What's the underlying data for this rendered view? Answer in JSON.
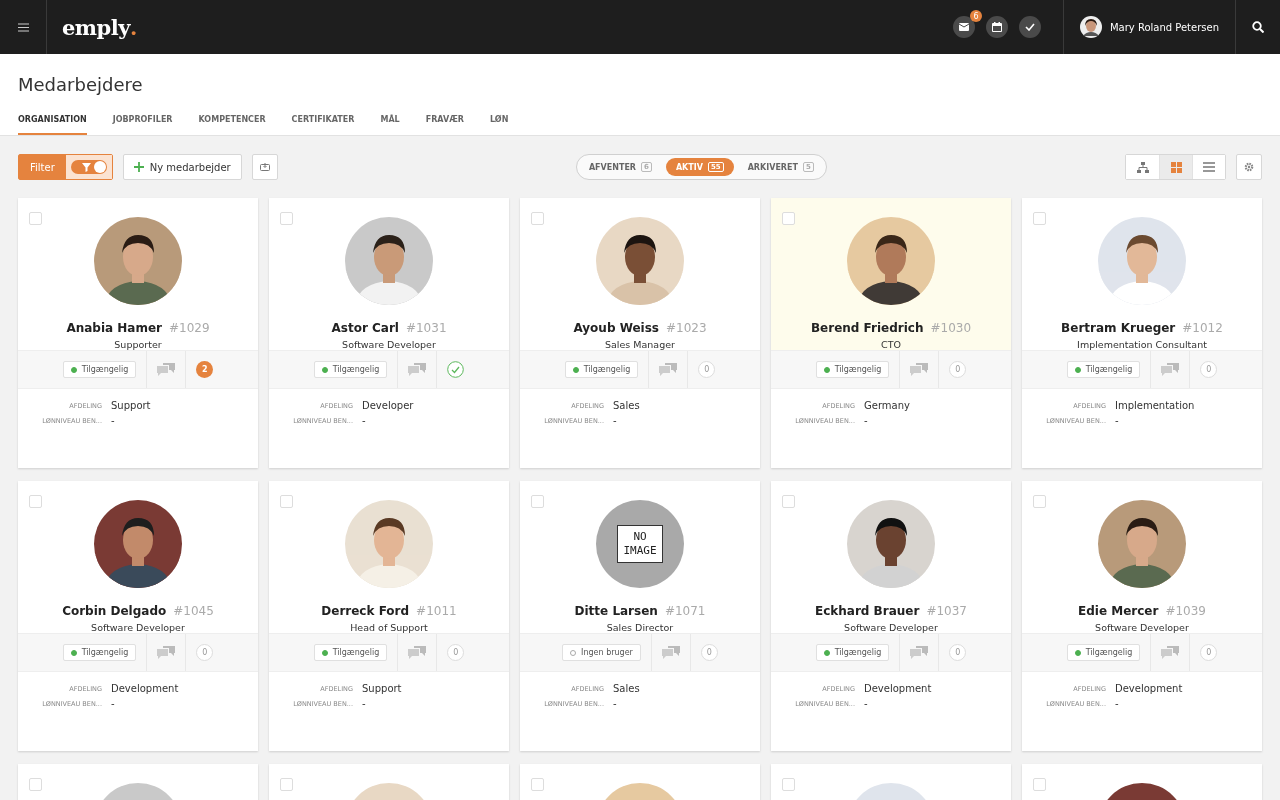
{
  "topbar": {
    "logo": "emply",
    "logo_dot": ".",
    "mail_badge": "6",
    "user": {
      "name": "Mary Roland Petersen"
    }
  },
  "page": {
    "title": "Medarbejdere"
  },
  "tabs": [
    {
      "label": "ORGANISATION",
      "selected": true
    },
    {
      "label": "JOBPROFILER",
      "selected": false
    },
    {
      "label": "KOMPETENCER",
      "selected": false
    },
    {
      "label": "CERTIFIKATER",
      "selected": false
    },
    {
      "label": "MÅL",
      "selected": false
    },
    {
      "label": "FRAVÆR",
      "selected": false
    },
    {
      "label": "LØN",
      "selected": false
    }
  ],
  "toolbar": {
    "filter": {
      "label": "Filter",
      "on": true
    },
    "new_button": {
      "label": "Ny medarbejder"
    },
    "segments": [
      {
        "label": "AFVENTER",
        "count": "6",
        "selected": false
      },
      {
        "label": "AKTIV",
        "count": "55",
        "selected": true
      },
      {
        "label": "ARKIVERET",
        "count": "5",
        "selected": false
      }
    ],
    "views": [
      {
        "kind": "org",
        "selected": false
      },
      {
        "kind": "grid",
        "selected": true
      },
      {
        "kind": "list",
        "selected": false
      }
    ]
  },
  "cards": [
    {
      "name": "Anabia Hamer",
      "number": "#1029",
      "title": "Supporter",
      "checked": false,
      "highlighted": false,
      "status": {
        "kind": "available",
        "label": "Tilgængelig"
      },
      "counter": {
        "kind": "badge",
        "value": "2"
      },
      "fields": [
        {
          "label": "AFDELING",
          "value": "Support"
        },
        {
          "label": "LØNNIVEAU BEN...",
          "value": "-"
        }
      ]
    },
    {
      "name": "Astor Carl",
      "number": "#1031",
      "title": "Software Developer",
      "checked": false,
      "highlighted": false,
      "status": {
        "kind": "available",
        "label": "Tilgængelig"
      },
      "counter": {
        "kind": "done"
      },
      "fields": [
        {
          "label": "AFDELING",
          "value": "Developer"
        },
        {
          "label": "LØNNIVEAU BEN...",
          "value": "-"
        }
      ]
    },
    {
      "name": "Ayoub Weiss",
      "number": "#1023",
      "title": "Sales Manager",
      "checked": false,
      "highlighted": false,
      "status": {
        "kind": "available",
        "label": "Tilgængelig"
      },
      "counter": {
        "kind": "count",
        "value": "0"
      },
      "fields": [
        {
          "label": "AFDELING",
          "value": "Sales"
        },
        {
          "label": "LØNNIVEAU BEN...",
          "value": "-"
        }
      ]
    },
    {
      "name": "Berend Friedrich",
      "number": "#1030",
      "title": "CTO",
      "checked": false,
      "highlighted": true,
      "status": {
        "kind": "available",
        "label": "Tilgængelig"
      },
      "counter": {
        "kind": "count",
        "value": "0"
      },
      "fields": [
        {
          "label": "AFDELING",
          "value": "Germany"
        },
        {
          "label": "LØNNIVEAU BEN...",
          "value": "-"
        }
      ]
    },
    {
      "name": "Bertram Krueger",
      "number": "#1012",
      "title": "Implementation Consultant",
      "checked": false,
      "highlighted": false,
      "status": {
        "kind": "available",
        "label": "Tilgængelig"
      },
      "counter": {
        "kind": "count",
        "value": "0"
      },
      "fields": [
        {
          "label": "AFDELING",
          "value": "Implementation"
        },
        {
          "label": "LØNNIVEAU BEN...",
          "value": "-"
        }
      ]
    },
    {
      "name": "Corbin Delgado",
      "number": "#1045",
      "title": "Software Developer",
      "checked": false,
      "highlighted": false,
      "status": {
        "kind": "available",
        "label": "Tilgængelig"
      },
      "counter": {
        "kind": "count",
        "value": "0"
      },
      "fields": [
        {
          "label": "AFDELING",
          "value": "Development"
        },
        {
          "label": "LØNNIVEAU BEN...",
          "value": "-"
        }
      ]
    },
    {
      "name": "Derreck Ford",
      "number": "#1011",
      "title": "Head of Support",
      "checked": false,
      "highlighted": false,
      "status": {
        "kind": "available",
        "label": "Tilgængelig"
      },
      "counter": {
        "kind": "count",
        "value": "0"
      },
      "fields": [
        {
          "label": "AFDELING",
          "value": "Support"
        },
        {
          "label": "LØNNIVEAU BEN...",
          "value": "-"
        }
      ]
    },
    {
      "name": "Ditte Larsen",
      "number": "#1071",
      "title": "Sales Director",
      "checked": false,
      "highlighted": false,
      "avatar": {
        "kind": "placeholder",
        "text": "NO IMAGE"
      },
      "status": {
        "kind": "no-user",
        "label": "Ingen bruger"
      },
      "counter": {
        "kind": "count",
        "value": "0"
      },
      "fields": [
        {
          "label": "AFDELING",
          "value": "Sales"
        },
        {
          "label": "LØNNIVEAU BEN...",
          "value": "-"
        }
      ]
    },
    {
      "name": "Eckhard Brauer",
      "number": "#1037",
      "title": "Software Developer",
      "checked": false,
      "highlighted": false,
      "status": {
        "kind": "available",
        "label": "Tilgængelig"
      },
      "counter": {
        "kind": "count",
        "value": "0"
      },
      "fields": [
        {
          "label": "AFDELING",
          "value": "Development"
        },
        {
          "label": "LØNNIVEAU BEN...",
          "value": "-"
        }
      ]
    },
    {
      "name": "Edie Mercer",
      "number": "#1039",
      "title": "Software Developer",
      "checked": false,
      "highlighted": false,
      "status": {
        "kind": "available",
        "label": "Tilgængelig"
      },
      "counter": {
        "kind": "count",
        "value": "0"
      },
      "fields": [
        {
          "label": "AFDELING",
          "value": "Development"
        },
        {
          "label": "LØNNIVEAU BEN...",
          "value": "-"
        }
      ]
    },
    {
      "checked": false,
      "highlighted": false
    },
    {
      "checked": false,
      "highlighted": false
    },
    {
      "checked": false,
      "highlighted": false
    },
    {
      "checked": false,
      "highlighted": false
    },
    {
      "checked": false,
      "highlighted": false
    }
  ]
}
